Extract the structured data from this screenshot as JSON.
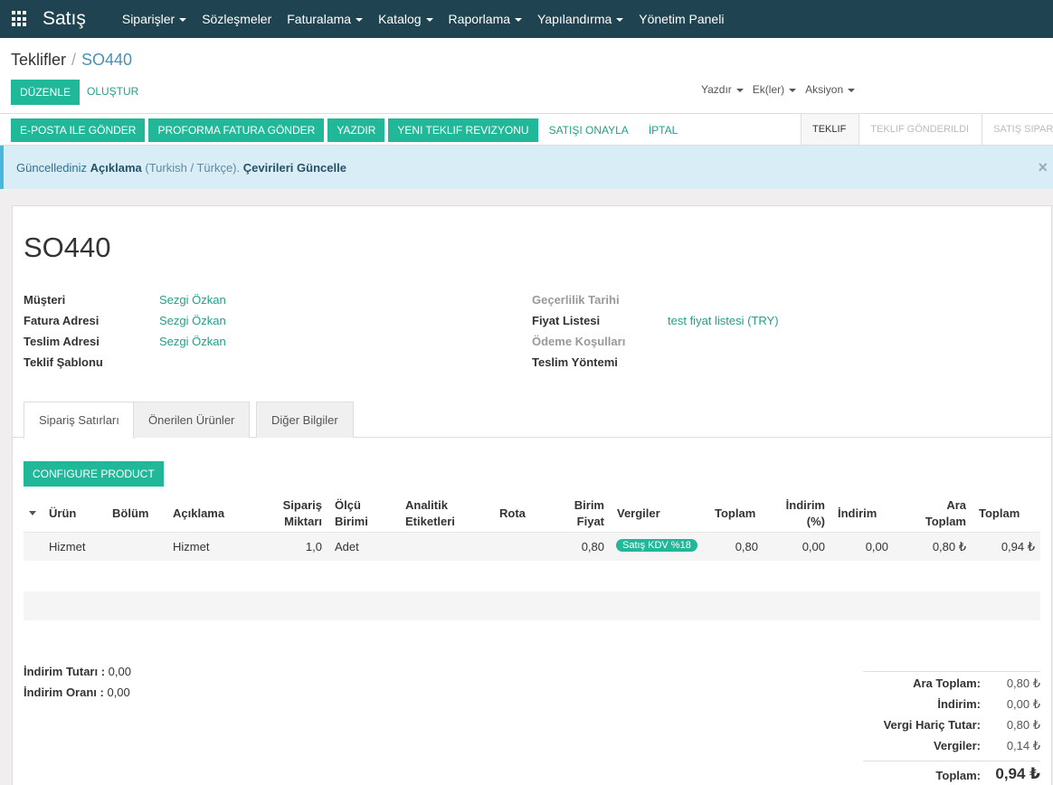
{
  "app": {
    "name": "Satış"
  },
  "nav": {
    "items": [
      {
        "label": "Siparişler",
        "dropdown": true
      },
      {
        "label": "Sözleşmeler",
        "dropdown": false
      },
      {
        "label": "Faturalama",
        "dropdown": true
      },
      {
        "label": "Katalog",
        "dropdown": true
      },
      {
        "label": "Raporlama",
        "dropdown": true
      },
      {
        "label": "Yapılandırma",
        "dropdown": true
      },
      {
        "label": "Yönetim Paneli",
        "dropdown": false
      }
    ]
  },
  "breadcrumb": {
    "root": "Teklifler",
    "separator": "/",
    "current": "SO440"
  },
  "control": {
    "edit_label": "DÜZENLE",
    "create_label": "OLUŞTUR",
    "print_label": "Yazdır",
    "attachments_label": "Ek(ler)",
    "action_label": "Aksiyon"
  },
  "statusbar": {
    "buttons": [
      "E-POSTA ILE GÖNDER",
      "PROFORMA FATURA GÖNDER",
      "YAZDIR",
      "YENI TEKLIF REVIZYONU"
    ],
    "links": [
      "SATIŞI ONAYLA",
      "İPTAL"
    ],
    "stages": [
      {
        "label": "TEKLIF",
        "active": true
      },
      {
        "label": "TEKLIF GÖNDERILDI",
        "active": false
      },
      {
        "label": "SATIŞ SIPARIŞI",
        "active": false
      }
    ]
  },
  "alert": {
    "prefix": "Güncellediniz",
    "field": "Açıklama",
    "lang": "(Turkish / Türkçe).",
    "action": "Çevirileri Güncelle",
    "close": "×"
  },
  "record": {
    "name": "SO440",
    "left_fields": [
      {
        "label": "Müşteri",
        "value": "Sezgi Özkan"
      },
      {
        "label": "Fatura Adresi",
        "value": "Sezgi Özkan"
      },
      {
        "label": "Teslim Adresi",
        "value": "Sezgi Özkan"
      },
      {
        "label": "Teklif Şablonu",
        "value": ""
      }
    ],
    "right_fields": [
      {
        "label": "Geçerlilik Tarihi",
        "value": "",
        "muted": true
      },
      {
        "label": "Fiyat Listesi",
        "value": "test fiyat listesi (TRY)",
        "muted": false
      },
      {
        "label": "Ödeme Koşulları",
        "value": "",
        "muted": true
      },
      {
        "label": "Teslim Yöntemi",
        "value": "",
        "muted": false
      }
    ]
  },
  "tabs": [
    "Sipariş Satırları",
    "Önerilen Ürünler",
    "Diğer Bilgiler"
  ],
  "configure_label": "CONFIGURE PRODUCT",
  "table": {
    "headers": {
      "product": "Ürün",
      "section": "Bölüm",
      "description": "Açıklama",
      "qty_1": "Sipariş",
      "qty_2": "Miktarı",
      "uom_1": "Ölçü",
      "uom_2": "Birimi",
      "analytic_1": "Analitik",
      "analytic_2": "Etiketleri",
      "route": "Rota",
      "price_1": "Birim",
      "price_2": "Fiyat",
      "taxes": "Vergiler",
      "total": "Toplam",
      "disc_pct_1": "İndirim",
      "disc_pct_2": "(%)",
      "discount": "İndirim",
      "subtotal_1": "Ara",
      "subtotal_2": "Toplam",
      "total2": "Toplam"
    },
    "rows": [
      {
        "product": "Hizmet",
        "description": "Hizmet",
        "qty": "1,0",
        "uom": "Adet",
        "price": "0,80",
        "tax": "Satış KDV %18",
        "total": "0,80",
        "disc_pct": "0,00",
        "discount": "0,00",
        "subtotal": "0,80 ₺",
        "total2": "0,94 ₺"
      }
    ]
  },
  "discount": {
    "amount_label": "İndirim Tutarı :",
    "amount_value": "0,00",
    "rate_label": "İndirim Oranı :",
    "rate_value": "0,00"
  },
  "totals": {
    "subtotal_label": "Ara Toplam:",
    "subtotal": "0,80 ₺",
    "discount_label": "İndirim:",
    "discount": "0,00 ₺",
    "untaxed_label": "Vergi Hariç Tutar:",
    "untaxed": "0,80 ₺",
    "taxes_label": "Vergiler:",
    "taxes": "0,14 ₺",
    "grand_label": "Toplam:",
    "grand": "0,94 ₺"
  }
}
